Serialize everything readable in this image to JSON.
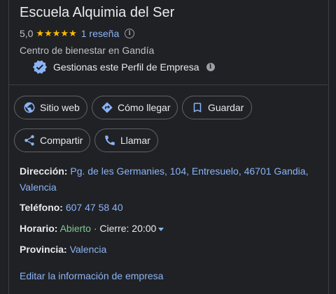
{
  "business": {
    "name": "Escuela Alquimia del Ser",
    "rating": "5,0",
    "stars": "★★★★★",
    "review_count": "1 reseña",
    "category": "Centro de bienestar en Gandía",
    "managed_text": "Gestionas este Perfil de Empresa"
  },
  "actions": {
    "website": "Sitio web",
    "directions": "Cómo llegar",
    "save": "Guardar",
    "share": "Compartir",
    "call": "Llamar"
  },
  "details": {
    "address_label": "Dirección:",
    "address_value": "Pg. de les Germanies, 104, Entresuelo, 46701 Gandia, Valencia",
    "phone_label": "Teléfono:",
    "phone_value": "607 47 58 40",
    "hours_label": "Horario:",
    "hours_status": "Abierto",
    "hours_separator": " · ",
    "hours_close": "Cierre: 20:00",
    "province_label": "Provincia:",
    "province_value": "Valencia"
  },
  "edit_link": "Editar la información de empresa",
  "colors": {
    "background": "#202124",
    "link": "#8ab4f8",
    "open": "#81c995",
    "star": "#fbbc04",
    "verified": "#8ab4f8"
  }
}
